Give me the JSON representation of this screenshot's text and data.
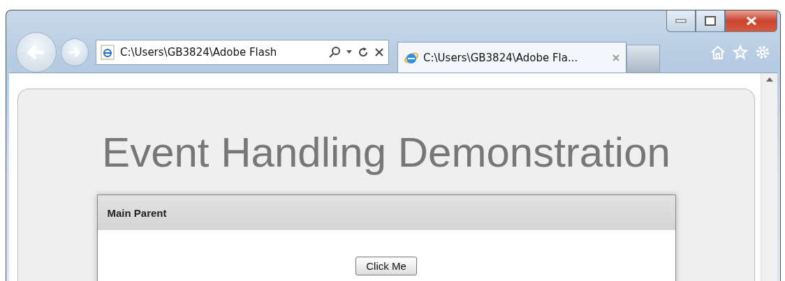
{
  "address_bar": {
    "value": "C:\\Users\\GB3824\\Adobe Flash"
  },
  "tabs": [
    {
      "label": "C:\\Users\\GB3824\\Adobe Fla...",
      "selected": true
    }
  ],
  "page": {
    "title": "Event Handling Demonstration",
    "panel": {
      "title": "Main Parent",
      "button": "Click Me"
    }
  }
}
